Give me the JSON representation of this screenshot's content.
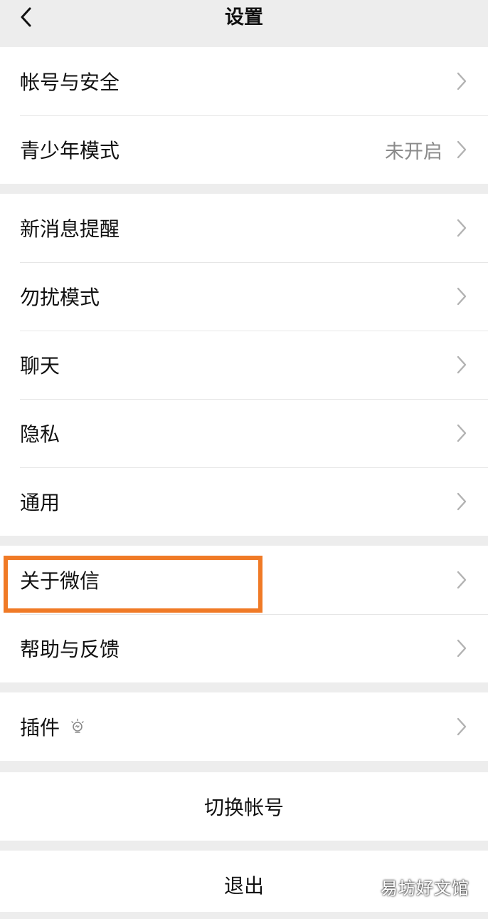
{
  "header": {
    "title": "设置",
    "back_icon": "chevron-left-icon"
  },
  "groups": [
    {
      "rows": [
        {
          "label": "帐号与安全"
        },
        {
          "label": "青少年模式",
          "value": "未开启"
        }
      ]
    },
    {
      "rows": [
        {
          "label": "新消息提醒"
        },
        {
          "label": "勿扰模式"
        },
        {
          "label": "聊天"
        },
        {
          "label": "隐私"
        },
        {
          "label": "通用"
        }
      ]
    },
    {
      "rows": [
        {
          "label": "关于微信",
          "highlighted": true
        },
        {
          "label": "帮助与反馈"
        }
      ]
    },
    {
      "rows": [
        {
          "label": "插件",
          "icon": "lightbulb-icon"
        }
      ]
    }
  ],
  "actions": {
    "switch_account": "切换帐号",
    "logout": "退出"
  },
  "watermark": "易坊好文馆",
  "colors": {
    "background": "#ededed",
    "card": "#ffffff",
    "highlight": "#f07a26",
    "secondary_text": "#8a8a8a"
  }
}
